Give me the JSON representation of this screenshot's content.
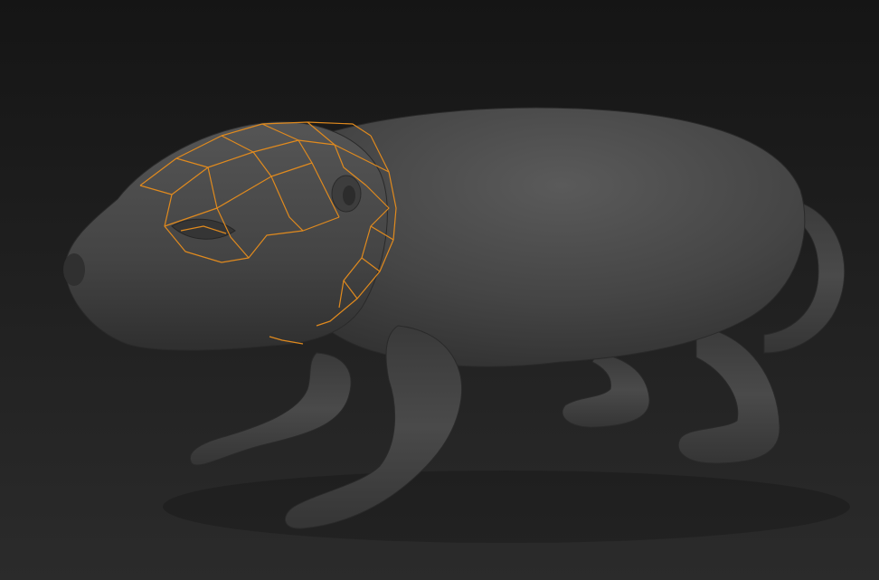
{
  "viewport": {
    "background_top": "#151515",
    "background_bottom": "#2b2b2b"
  },
  "model": {
    "subject": "rodent-sculpt",
    "base_color": "#4a4a4a",
    "highlight_color": "#5c5c5c",
    "shadow_color": "#2e2e2e"
  },
  "selection": {
    "wireframe_color": "#e08a1e",
    "region": "head-and-neck"
  }
}
